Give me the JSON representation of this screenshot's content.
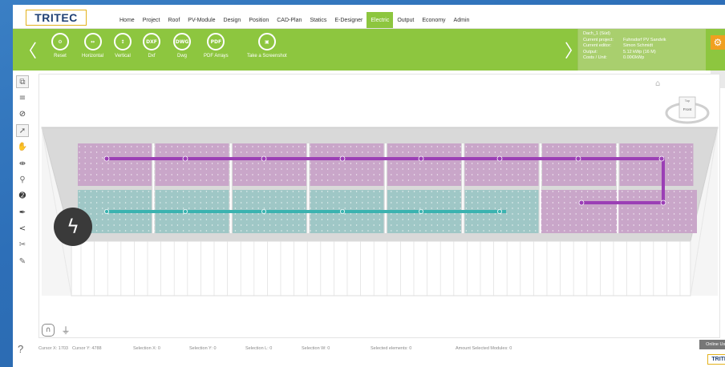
{
  "app": {
    "logo": "TRITEC",
    "mini_logo": "TRITEC"
  },
  "menu": {
    "items": [
      "Home",
      "Project",
      "Roof",
      "PV-Module",
      "Design",
      "Position",
      "CAD-Plan",
      "Statics",
      "E-Designer",
      "Electric",
      "Output",
      "Economy",
      "Admin"
    ],
    "active": "Electric"
  },
  "toolbar": {
    "tools": [
      {
        "label": "Reset",
        "glyph": "⚙",
        "icon": "reset-icon"
      },
      {
        "label": "Horizontal",
        "glyph": "↔",
        "icon": "horizontal-icon"
      },
      {
        "label": "Vertical",
        "glyph": "↕",
        "icon": "vertical-icon"
      },
      {
        "label": "Dxf",
        "glyph": "DXF",
        "icon": "dxf-icon"
      },
      {
        "label": "Dwg",
        "glyph": "DWG",
        "icon": "dwg-icon"
      },
      {
        "label": "PDF Arrays",
        "glyph": "PDF",
        "icon": "pdf-icon"
      },
      {
        "label": "Take a Screenshot",
        "glyph": "▣",
        "icon": "screenshot-icon"
      }
    ],
    "prev": "〈",
    "next": "〉"
  },
  "info": {
    "title": "Dach_1 (Süd)",
    "rows": [
      {
        "key": "Current project:",
        "value": "Fuhrsdorf PV Sandvik"
      },
      {
        "key": "Current editor:",
        "value": "Simon Schmidt"
      },
      {
        "key": "Output:",
        "value": "5.12 kWp (16 M)"
      },
      {
        "key": "Costs / Unit:",
        "value": "0.00€/kWp"
      }
    ]
  },
  "view_cube": {
    "top": "Top",
    "front": "Front"
  },
  "colors": {
    "accent": "#8dc63f",
    "string_purple": "#9b3fb5",
    "string_teal": "#3bb3b0",
    "module_purple": "#c9a6c9",
    "module_teal": "#9fc7c6",
    "roof": "#d9d9d9"
  },
  "status": {
    "cursor_x": "Cursor X: 1703",
    "cursor_y": "Cursor Y: 4788",
    "selection_x": "Selection X: 0",
    "selection_y": "Selection Y: 0",
    "selection_l": "Selection L: 0",
    "selection_w": "Selection W: 0",
    "selected_elements": "Selected elements: 0",
    "amount_modules": "Amount Selected Modules: 0"
  },
  "online_users": "Online Users",
  "help": "?"
}
